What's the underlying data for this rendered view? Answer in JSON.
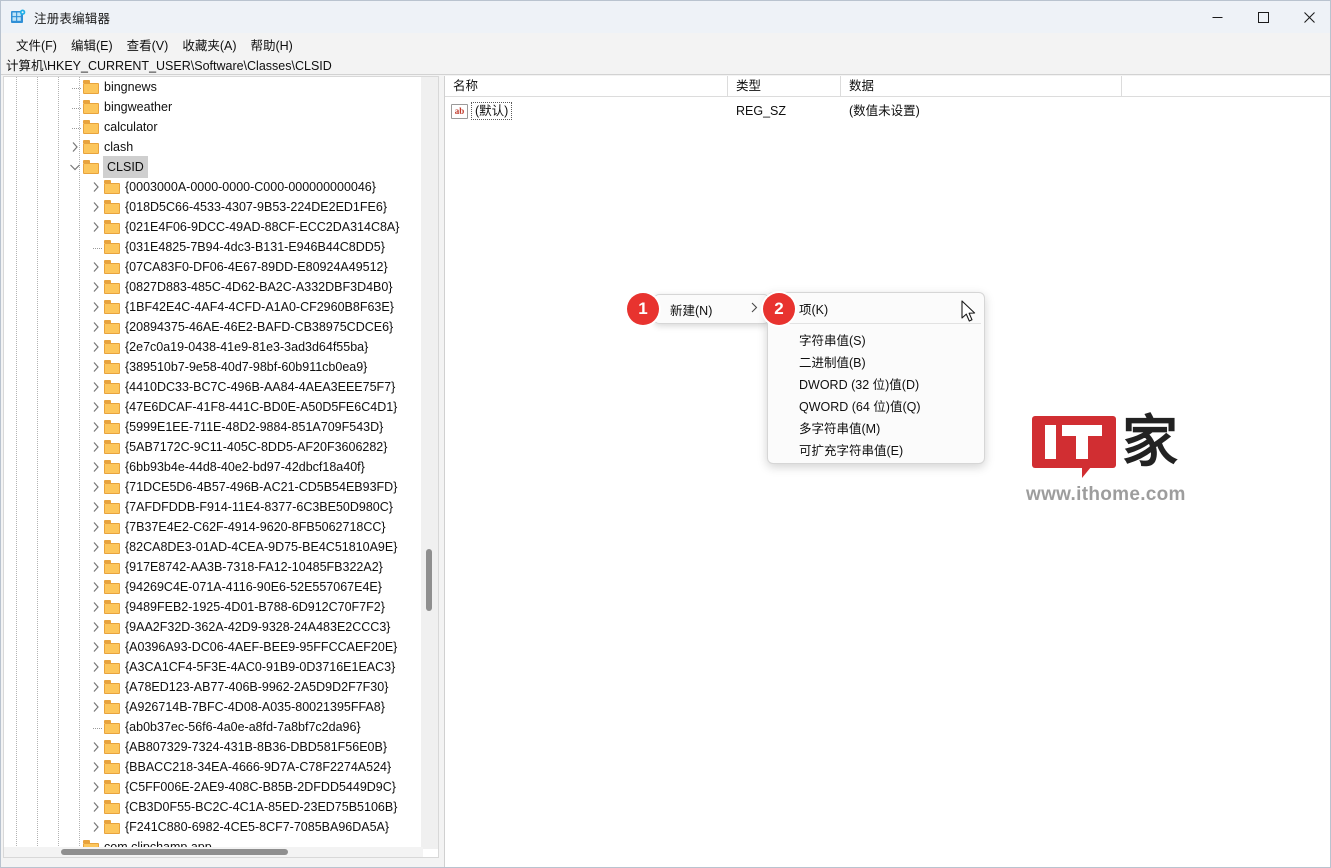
{
  "window": {
    "title": "注册表编辑器",
    "icon": "registry-editor-icon",
    "minimize_label": "—",
    "maximize_label": "☐",
    "close_label": "✕"
  },
  "menubar": {
    "items": [
      {
        "label": "文件(F)",
        "name": "menu-file"
      },
      {
        "label": "编辑(E)",
        "name": "menu-edit"
      },
      {
        "label": "查看(V)",
        "name": "menu-view"
      },
      {
        "label": "收藏夹(A)",
        "name": "menu-favorites"
      },
      {
        "label": "帮助(H)",
        "name": "menu-help"
      }
    ]
  },
  "address": {
    "path": "计算机\\HKEY_CURRENT_USER\\Software\\Classes\\CLSID"
  },
  "tree": {
    "rows": [
      {
        "label": "bingnews",
        "indent": 4,
        "toggle": "stub",
        "selected": false
      },
      {
        "label": "bingweather",
        "indent": 4,
        "toggle": "stub",
        "selected": false
      },
      {
        "label": "calculator",
        "indent": 4,
        "toggle": "stub",
        "selected": false
      },
      {
        "label": "clash",
        "indent": 4,
        "toggle": "collapsed",
        "selected": false
      },
      {
        "label": "CLSID",
        "indent": 4,
        "toggle": "expanded",
        "selected": true
      },
      {
        "label": "{0003000A-0000-0000-C000-000000000046}",
        "indent": 5,
        "toggle": "collapsed",
        "selected": false
      },
      {
        "label": "{018D5C66-4533-4307-9B53-224DE2ED1FE6}",
        "indent": 5,
        "toggle": "collapsed",
        "selected": false
      },
      {
        "label": "{021E4F06-9DCC-49AD-88CF-ECC2DA314C8A}",
        "indent": 5,
        "toggle": "collapsed",
        "selected": false
      },
      {
        "label": "{031E4825-7B94-4dc3-B131-E946B44C8DD5}",
        "indent": 5,
        "toggle": "stub",
        "selected": false
      },
      {
        "label": "{07CA83F0-DF06-4E67-89DD-E80924A49512}",
        "indent": 5,
        "toggle": "collapsed",
        "selected": false
      },
      {
        "label": "{0827D883-485C-4D62-BA2C-A332DBF3D4B0}",
        "indent": 5,
        "toggle": "collapsed",
        "selected": false
      },
      {
        "label": "{1BF42E4C-4AF4-4CFD-A1A0-CF2960B8F63E}",
        "indent": 5,
        "toggle": "collapsed",
        "selected": false
      },
      {
        "label": "{20894375-46AE-46E2-BAFD-CB38975CDCE6}",
        "indent": 5,
        "toggle": "collapsed",
        "selected": false
      },
      {
        "label": "{2e7c0a19-0438-41e9-81e3-3ad3d64f55ba}",
        "indent": 5,
        "toggle": "collapsed",
        "selected": false
      },
      {
        "label": "{389510b7-9e58-40d7-98bf-60b911cb0ea9}",
        "indent": 5,
        "toggle": "collapsed",
        "selected": false
      },
      {
        "label": "{4410DC33-BC7C-496B-AA84-4AEA3EEE75F7}",
        "indent": 5,
        "toggle": "collapsed",
        "selected": false
      },
      {
        "label": "{47E6DCAF-41F8-441C-BD0E-A50D5FE6C4D1}",
        "indent": 5,
        "toggle": "collapsed",
        "selected": false
      },
      {
        "label": "{5999E1EE-711E-48D2-9884-851A709F543D}",
        "indent": 5,
        "toggle": "collapsed",
        "selected": false
      },
      {
        "label": "{5AB7172C-9C11-405C-8DD5-AF20F3606282}",
        "indent": 5,
        "toggle": "collapsed",
        "selected": false
      },
      {
        "label": "{6bb93b4e-44d8-40e2-bd97-42dbcf18a40f}",
        "indent": 5,
        "toggle": "collapsed",
        "selected": false
      },
      {
        "label": "{71DCE5D6-4B57-496B-AC21-CD5B54EB93FD}",
        "indent": 5,
        "toggle": "collapsed",
        "selected": false
      },
      {
        "label": "{7AFDFDDB-F914-11E4-8377-6C3BE50D980C}",
        "indent": 5,
        "toggle": "collapsed",
        "selected": false
      },
      {
        "label": "{7B37E4E2-C62F-4914-9620-8FB5062718CC}",
        "indent": 5,
        "toggle": "collapsed",
        "selected": false
      },
      {
        "label": "{82CA8DE3-01AD-4CEA-9D75-BE4C51810A9E}",
        "indent": 5,
        "toggle": "collapsed",
        "selected": false
      },
      {
        "label": "{917E8742-AA3B-7318-FA12-10485FB322A2}",
        "indent": 5,
        "toggle": "collapsed",
        "selected": false
      },
      {
        "label": "{94269C4E-071A-4116-90E6-52E557067E4E}",
        "indent": 5,
        "toggle": "collapsed",
        "selected": false
      },
      {
        "label": "{9489FEB2-1925-4D01-B788-6D912C70F7F2}",
        "indent": 5,
        "toggle": "collapsed",
        "selected": false
      },
      {
        "label": "{9AA2F32D-362A-42D9-9328-24A483E2CCC3}",
        "indent": 5,
        "toggle": "collapsed",
        "selected": false
      },
      {
        "label": "{A0396A93-DC06-4AEF-BEE9-95FFCCAEF20E}",
        "indent": 5,
        "toggle": "collapsed",
        "selected": false
      },
      {
        "label": "{A3CA1CF4-5F3E-4AC0-91B9-0D3716E1EAC3}",
        "indent": 5,
        "toggle": "collapsed",
        "selected": false
      },
      {
        "label": "{A78ED123-AB77-406B-9962-2A5D9D2F7F30}",
        "indent": 5,
        "toggle": "collapsed",
        "selected": false
      },
      {
        "label": "{A926714B-7BFC-4D08-A035-80021395FFA8}",
        "indent": 5,
        "toggle": "collapsed",
        "selected": false
      },
      {
        "label": "{ab0b37ec-56f6-4a0e-a8fd-7a8bf7c2da96}",
        "indent": 5,
        "toggle": "stub",
        "selected": false
      },
      {
        "label": "{AB807329-7324-431B-8B36-DBD581F56E0B}",
        "indent": 5,
        "toggle": "collapsed",
        "selected": false
      },
      {
        "label": "{BBACC218-34EA-4666-9D7A-C78F2274A524}",
        "indent": 5,
        "toggle": "collapsed",
        "selected": false
      },
      {
        "label": "{C5FF006E-2AE9-408C-B85B-2DFDD5449D9C}",
        "indent": 5,
        "toggle": "collapsed",
        "selected": false
      },
      {
        "label": "{CB3D0F55-BC2C-4C1A-85ED-23ED75B5106B}",
        "indent": 5,
        "toggle": "collapsed",
        "selected": false
      },
      {
        "label": "{F241C880-6982-4CE5-8CF7-7085BA96DA5A}",
        "indent": 5,
        "toggle": "collapsed",
        "selected": false
      },
      {
        "label": "com.clipchamp.app",
        "indent": 4,
        "toggle": "stub",
        "selected": false
      }
    ]
  },
  "values": {
    "columns": [
      "名称",
      "类型",
      "数据"
    ],
    "rows": [
      {
        "name": "(默认)",
        "type": "REG_SZ",
        "data": "(数值未设置)",
        "icon": "ab"
      }
    ]
  },
  "context_menu": {
    "parent": {
      "label": "新建(N)",
      "submenu_arrow": "›"
    },
    "submenu": [
      {
        "label": "项(K)",
        "separator_after": true
      },
      {
        "label": "字符串值(S)",
        "separator_after": false
      },
      {
        "label": "二进制值(B)",
        "separator_after": false
      },
      {
        "label": "DWORD (32 位)值(D)",
        "separator_after": false
      },
      {
        "label": "QWORD (64 位)值(Q)",
        "separator_after": false
      },
      {
        "label": "多字符串值(M)",
        "separator_after": false
      },
      {
        "label": "可扩充字符串值(E)",
        "separator_after": false
      }
    ]
  },
  "badges": [
    {
      "number": "1"
    },
    {
      "number": "2"
    }
  ],
  "watermark": {
    "logo_text": "IT",
    "cjk": "家",
    "url": "www.ithome.com"
  },
  "colors": {
    "badge_red": "#e8332f",
    "logo_red": "#d0262a",
    "folder": "#fcc65c",
    "titlebar": "#eef2f7"
  }
}
